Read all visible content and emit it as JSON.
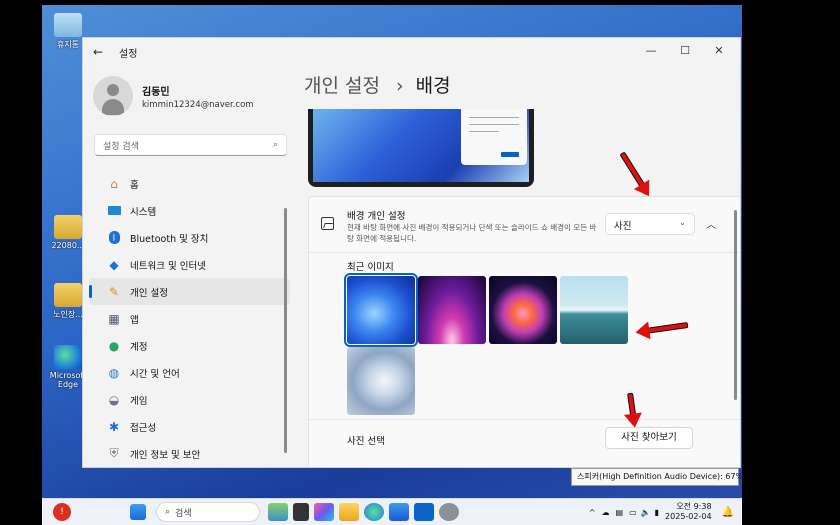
{
  "desktop": {
    "icons": [
      {
        "label": "휴지통"
      },
      {
        "label": "22080..."
      },
      {
        "label": "노인장..."
      },
      {
        "label": "Microsoft Edge"
      }
    ]
  },
  "window": {
    "title": "설정",
    "controls": {
      "minimize": "—",
      "maximize": "☐",
      "close": "✕"
    }
  },
  "profile": {
    "name": "김동민",
    "email": "kimmin12324@naver.com"
  },
  "search": {
    "placeholder": "설정 검색"
  },
  "nav": {
    "items": [
      {
        "label": "홈",
        "icon": "home-icon"
      },
      {
        "label": "시스템",
        "icon": "system-icon"
      },
      {
        "label": "Bluetooth 및 장치",
        "icon": "bluetooth-icon"
      },
      {
        "label": "네트워크 및 인터넷",
        "icon": "wifi-icon"
      },
      {
        "label": "개인 설정",
        "icon": "brush-icon",
        "active": true
      },
      {
        "label": "앱",
        "icon": "apps-icon"
      },
      {
        "label": "계정",
        "icon": "account-icon"
      },
      {
        "label": "시간 및 언어",
        "icon": "globe-icon"
      },
      {
        "label": "게임",
        "icon": "gamepad-icon"
      },
      {
        "label": "접근성",
        "icon": "accessibility-icon"
      },
      {
        "label": "개인 정보 및 보안",
        "icon": "shield-icon"
      }
    ]
  },
  "page": {
    "breadcrumb_parent": "개인 설정",
    "separator": "›",
    "title": "배경"
  },
  "background": {
    "title": "배경 개인 설정",
    "description": "현재 바탕 화면에 사진 배경이 적용되거나 단색 또는 슬라이드 쇼 배경이 모든 바탕 화면에 적용됩니다.",
    "selected": "사진",
    "recent_label": "최근 이미지",
    "choose_label": "사진 선택",
    "browse_label": "사진 찾아보기"
  },
  "tooltip": "스피커(High Definition Audio Device): 67%",
  "taskbar": {
    "search_label": "검색",
    "time": "오전 9:38",
    "date": "2025-02-04"
  },
  "colors": {
    "accent": "#0067c0",
    "arrow": "#e01010"
  }
}
